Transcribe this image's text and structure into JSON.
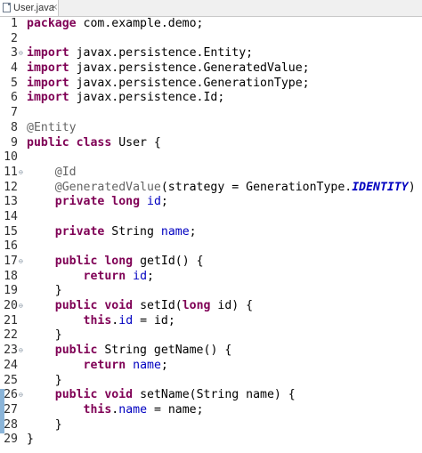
{
  "tab": {
    "title": "User.java",
    "close_glyph": "×",
    "icon": "java-file-icon"
  },
  "editor": {
    "fold_marker": "⊖",
    "lines": [
      {
        "number": "1",
        "fold": false,
        "tokens": [
          {
            "t": "package",
            "s": "kw"
          },
          {
            "t": " com.example.demo;",
            "s": "plain"
          }
        ]
      },
      {
        "number": "2",
        "fold": false,
        "tokens": []
      },
      {
        "number": "3",
        "fold": true,
        "tokens": [
          {
            "t": "import",
            "s": "kw"
          },
          {
            "t": " javax.persistence.Entity;",
            "s": "plain"
          }
        ]
      },
      {
        "number": "4",
        "fold": false,
        "tokens": [
          {
            "t": "import",
            "s": "kw"
          },
          {
            "t": " javax.persistence.GeneratedValue;",
            "s": "plain"
          }
        ]
      },
      {
        "number": "5",
        "fold": false,
        "tokens": [
          {
            "t": "import",
            "s": "kw"
          },
          {
            "t": " javax.persistence.GenerationType;",
            "s": "plain"
          }
        ]
      },
      {
        "number": "6",
        "fold": false,
        "tokens": [
          {
            "t": "import",
            "s": "kw"
          },
          {
            "t": " javax.persistence.Id;",
            "s": "plain"
          }
        ]
      },
      {
        "number": "7",
        "fold": false,
        "tokens": []
      },
      {
        "number": "8",
        "fold": false,
        "tokens": [
          {
            "t": "@Entity",
            "s": "ann"
          }
        ]
      },
      {
        "number": "9",
        "fold": false,
        "tokens": [
          {
            "t": "public",
            "s": "kw"
          },
          {
            "t": " ",
            "s": "plain"
          },
          {
            "t": "class",
            "s": "kw"
          },
          {
            "t": " User {",
            "s": "plain"
          }
        ]
      },
      {
        "number": "10",
        "fold": false,
        "tokens": []
      },
      {
        "number": "11",
        "fold": true,
        "tokens": [
          {
            "t": "    ",
            "s": "plain"
          },
          {
            "t": "@Id",
            "s": "ann"
          }
        ]
      },
      {
        "number": "12",
        "fold": false,
        "tokens": [
          {
            "t": "    ",
            "s": "plain"
          },
          {
            "t": "@GeneratedValue",
            "s": "ann"
          },
          {
            "t": "(strategy = GenerationType.",
            "s": "plain"
          },
          {
            "t": "IDENTITY",
            "s": "const"
          },
          {
            "t": ")",
            "s": "plain"
          }
        ]
      },
      {
        "number": "13",
        "fold": false,
        "tokens": [
          {
            "t": "    ",
            "s": "plain"
          },
          {
            "t": "private",
            "s": "kw"
          },
          {
            "t": " ",
            "s": "plain"
          },
          {
            "t": "long",
            "s": "kw"
          },
          {
            "t": " ",
            "s": "plain"
          },
          {
            "t": "id",
            "s": "field"
          },
          {
            "t": ";",
            "s": "plain"
          }
        ]
      },
      {
        "number": "14",
        "fold": false,
        "tokens": []
      },
      {
        "number": "15",
        "fold": false,
        "tokens": [
          {
            "t": "    ",
            "s": "plain"
          },
          {
            "t": "private",
            "s": "kw"
          },
          {
            "t": " String ",
            "s": "plain"
          },
          {
            "t": "name",
            "s": "field"
          },
          {
            "t": ";",
            "s": "plain"
          }
        ]
      },
      {
        "number": "16",
        "fold": false,
        "tokens": []
      },
      {
        "number": "17",
        "fold": true,
        "tokens": [
          {
            "t": "    ",
            "s": "plain"
          },
          {
            "t": "public",
            "s": "kw"
          },
          {
            "t": " ",
            "s": "plain"
          },
          {
            "t": "long",
            "s": "kw"
          },
          {
            "t": " getId() {",
            "s": "plain"
          }
        ]
      },
      {
        "number": "18",
        "fold": false,
        "tokens": [
          {
            "t": "        ",
            "s": "plain"
          },
          {
            "t": "return",
            "s": "kw"
          },
          {
            "t": " ",
            "s": "plain"
          },
          {
            "t": "id",
            "s": "field"
          },
          {
            "t": ";",
            "s": "plain"
          }
        ]
      },
      {
        "number": "19",
        "fold": false,
        "tokens": [
          {
            "t": "    }",
            "s": "plain"
          }
        ]
      },
      {
        "number": "20",
        "fold": true,
        "tokens": [
          {
            "t": "    ",
            "s": "plain"
          },
          {
            "t": "public",
            "s": "kw"
          },
          {
            "t": " ",
            "s": "plain"
          },
          {
            "t": "void",
            "s": "kw"
          },
          {
            "t": " setId(",
            "s": "plain"
          },
          {
            "t": "long",
            "s": "kw"
          },
          {
            "t": " id) {",
            "s": "plain"
          }
        ]
      },
      {
        "number": "21",
        "fold": false,
        "tokens": [
          {
            "t": "        ",
            "s": "plain"
          },
          {
            "t": "this",
            "s": "kw"
          },
          {
            "t": ".",
            "s": "plain"
          },
          {
            "t": "id",
            "s": "field"
          },
          {
            "t": " = id;",
            "s": "plain"
          }
        ]
      },
      {
        "number": "22",
        "fold": false,
        "tokens": [
          {
            "t": "    }",
            "s": "plain"
          }
        ]
      },
      {
        "number": "23",
        "fold": true,
        "tokens": [
          {
            "t": "    ",
            "s": "plain"
          },
          {
            "t": "public",
            "s": "kw"
          },
          {
            "t": " String getName() {",
            "s": "plain"
          }
        ]
      },
      {
        "number": "24",
        "fold": false,
        "tokens": [
          {
            "t": "        ",
            "s": "plain"
          },
          {
            "t": "return",
            "s": "kw"
          },
          {
            "t": " ",
            "s": "plain"
          },
          {
            "t": "name",
            "s": "field"
          },
          {
            "t": ";",
            "s": "plain"
          }
        ]
      },
      {
        "number": "25",
        "fold": false,
        "tokens": [
          {
            "t": "    }",
            "s": "plain"
          }
        ]
      },
      {
        "number": "26",
        "fold": true,
        "tokens": [
          {
            "t": "    ",
            "s": "plain"
          },
          {
            "t": "public",
            "s": "kw"
          },
          {
            "t": " ",
            "s": "plain"
          },
          {
            "t": "void",
            "s": "kw"
          },
          {
            "t": " setName(String name) {",
            "s": "plain"
          }
        ]
      },
      {
        "number": "27",
        "fold": false,
        "tokens": [
          {
            "t": "        ",
            "s": "plain"
          },
          {
            "t": "this",
            "s": "kw"
          },
          {
            "t": ".",
            "s": "plain"
          },
          {
            "t": "name",
            "s": "field"
          },
          {
            "t": " = name;",
            "s": "plain"
          }
        ]
      },
      {
        "number": "28",
        "fold": false,
        "tokens": [
          {
            "t": "    }",
            "s": "plain"
          }
        ]
      },
      {
        "number": "29",
        "fold": false,
        "tokens": [
          {
            "t": "}",
            "s": "plain"
          }
        ]
      }
    ],
    "changed_lines": [
      "26",
      "27",
      "28"
    ]
  },
  "colors": {
    "keyword": "#7f0055",
    "annotation": "#646464",
    "field": "#0000c0",
    "text": "#000000",
    "change_marker": "#8ab4d8"
  }
}
